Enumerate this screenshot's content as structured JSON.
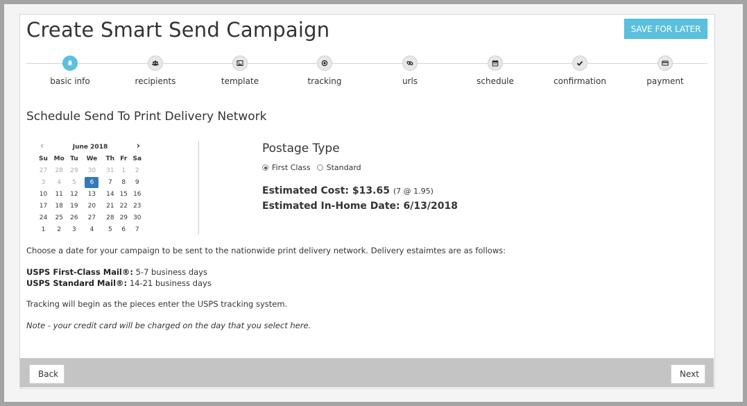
{
  "header": {
    "title": "Create Smart Send Campaign",
    "save_label": "SAVE FOR LATER"
  },
  "steps": [
    {
      "label": "basic info",
      "icon": "bell-icon",
      "active": true
    },
    {
      "label": "recipients",
      "icon": "users-icon",
      "active": false
    },
    {
      "label": "template",
      "icon": "image-icon",
      "active": false
    },
    {
      "label": "tracking",
      "icon": "target-icon",
      "active": false
    },
    {
      "label": "urls",
      "icon": "link-icon",
      "active": false
    },
    {
      "label": "schedule",
      "icon": "calendar-icon",
      "active": false
    },
    {
      "label": "confirmation",
      "icon": "check-icon",
      "active": false
    },
    {
      "label": "payment",
      "icon": "credit-card-icon",
      "active": false
    }
  ],
  "section_title": "Schedule Send To Print Delivery Network",
  "calendar": {
    "month_label": "June 2018",
    "prev_glyph": "‹",
    "next_glyph": "›",
    "weekdays": [
      "Su",
      "Mo",
      "Tu",
      "We",
      "Th",
      "Fr",
      "Sa"
    ],
    "weeks": [
      [
        "27",
        "28",
        "29",
        "30",
        "31",
        "1",
        "2"
      ],
      [
        "3",
        "4",
        "5",
        "6",
        "7",
        "8",
        "9"
      ],
      [
        "10",
        "11",
        "12",
        "13",
        "14",
        "15",
        "16"
      ],
      [
        "17",
        "18",
        "19",
        "20",
        "21",
        "22",
        "23"
      ],
      [
        "24",
        "25",
        "26",
        "27",
        "28",
        "29",
        "30"
      ],
      [
        "1",
        "2",
        "3",
        "4",
        "5",
        "6",
        "7"
      ]
    ],
    "selected_date": "6"
  },
  "postage": {
    "title": "Postage Type",
    "options": [
      {
        "label": "First Class",
        "checked": true
      },
      {
        "label": "Standard",
        "checked": false
      }
    ],
    "cost_label": "Estimated Cost:",
    "cost_value": "$13.65",
    "cost_detail": "(7 @ 1.95)",
    "inhome_label": "Estimated In-Home Date:",
    "inhome_value": "6/13/2018"
  },
  "info": {
    "intro": "Choose a date for your campaign to be sent to the nationwide print delivery network. Delivery estaimtes are as follows:",
    "first_class_label": "USPS First-Class Mail®:",
    "first_class_value": "5-7 business days",
    "standard_label": "USPS Standard Mail®:",
    "standard_value": "14-21 business days",
    "tracking_note": "Tracking will begin as the pieces enter the USPS tracking system.",
    "charge_note": "Note - your credit card will be charged on the day that you select here."
  },
  "footer": {
    "back_label": "Back",
    "next_label": "Next"
  },
  "colors": {
    "accent": "#5bc0de",
    "selected_day": "#337ab7",
    "footer_bar": "#c4c4c4"
  }
}
